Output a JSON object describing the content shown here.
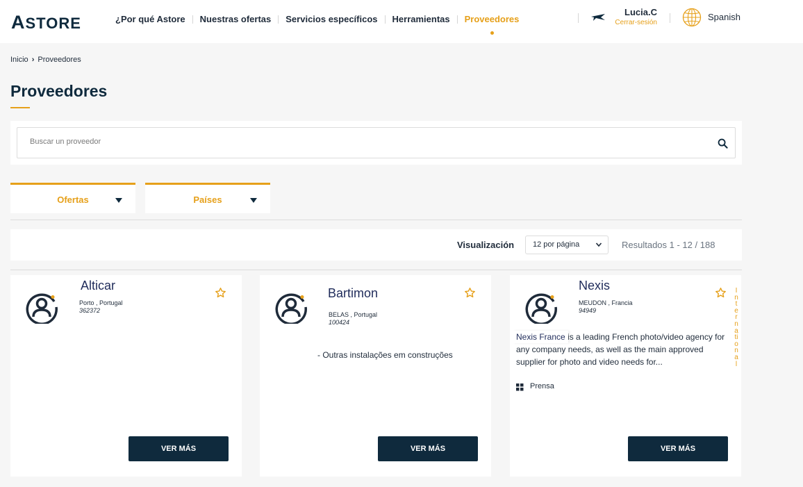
{
  "header": {
    "logo": "ASTORE",
    "logo_first": "A",
    "logo_rest": "STORE",
    "nav": [
      {
        "label": "¿Por qué Astore"
      },
      {
        "label": "Nuestras ofertas"
      },
      {
        "label": "Servicios específicos"
      },
      {
        "label": "Herramientas"
      },
      {
        "label": "Proveedores",
        "active": true
      }
    ],
    "user": {
      "name": "Lucia.C",
      "logout": "Cerrar-sesión"
    },
    "language": "Spanish"
  },
  "breadcrumb": {
    "home": "Inicio",
    "current": "Proveedores"
  },
  "page_title": "Proveedores",
  "search": {
    "placeholder": "Buscar un proveedor",
    "value": ""
  },
  "filters": [
    {
      "label": "Ofertas"
    },
    {
      "label": "Países"
    }
  ],
  "results": {
    "visualization_label": "Visualización",
    "per_page": "12 por página",
    "count": "Resultados 1 - 12 / 188"
  },
  "cards": [
    {
      "name": "Alticar",
      "location": "Porto , Portugal",
      "code": "362372",
      "description": "",
      "button": "VER MÁS"
    },
    {
      "name": "Bartimon",
      "location": "BELAS , Portugal",
      "code": "100424",
      "description": "- Outras instalações em construções",
      "button": "VER MÁS"
    },
    {
      "name": "Nexis",
      "location": "MEUDON , Francia",
      "code": "94949",
      "company": "Nexis France",
      "description": "Nexis France is a leading French photo/video agency for any company needs, as well as the main approved supplier for photo and video needs for...",
      "tag": "Prensa",
      "vertical_label": "International",
      "button": "VER MÁS"
    }
  ],
  "colors": {
    "accent": "#e6a01a",
    "navy": "#0f2a3d"
  }
}
